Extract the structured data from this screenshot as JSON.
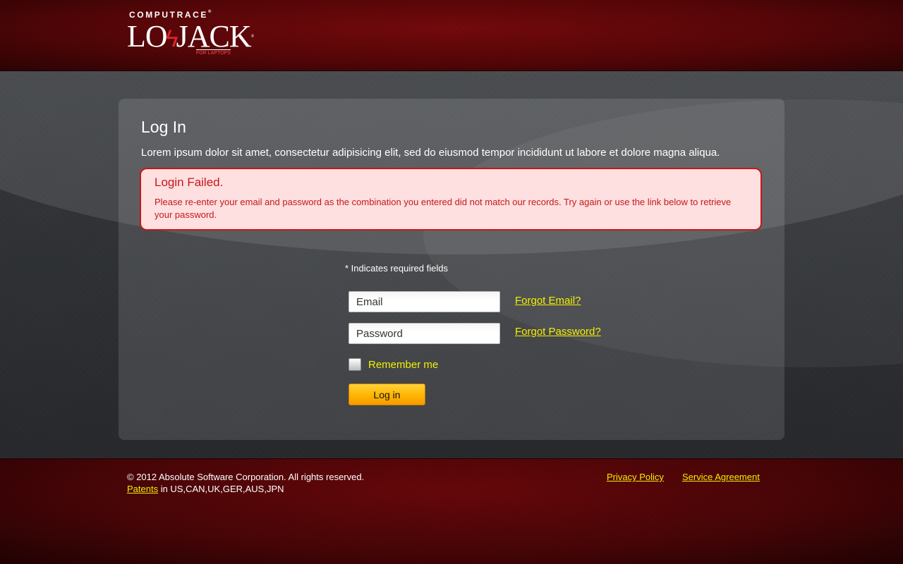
{
  "header": {
    "logo": {
      "top_text": "COMPUTRACE",
      "main_left": "LO",
      "main_right": "JACK",
      "sub_text": "FOR LAPTOPS"
    }
  },
  "login": {
    "title": "Log In",
    "description": "Lorem ipsum dolor sit amet, consectetur adipisicing elit, sed do eiusmod tempor incididunt ut labore et dolore magna aliqua.",
    "error": {
      "title": "Login Failed.",
      "message": "Please re-enter your email and password as the combination you entered did not match our records. Try again or use the link below to retrieve your password."
    },
    "required_note": "* Indicates required fields",
    "email_placeholder": "Email",
    "password_placeholder": "Password",
    "forgot_email": "Forgot Email?",
    "forgot_password": "Forgot Password?",
    "remember_label": "Remember me",
    "remember_checked": false,
    "login_button": "Log in"
  },
  "footer": {
    "copyright": "© 2012 Absolute Software Corporation. All rights reserved.",
    "patents_link": "Patents",
    "patents_suffix": " in US,CAN,UK,GER,AUS,JPN",
    "privacy_link": "Privacy Policy",
    "service_link": "Service Agreement"
  },
  "colors": {
    "brand_red": "#7a0a0d",
    "error_red": "#c8161c",
    "link_yellow": "#f4f000",
    "button_orange": "#ffb400"
  }
}
